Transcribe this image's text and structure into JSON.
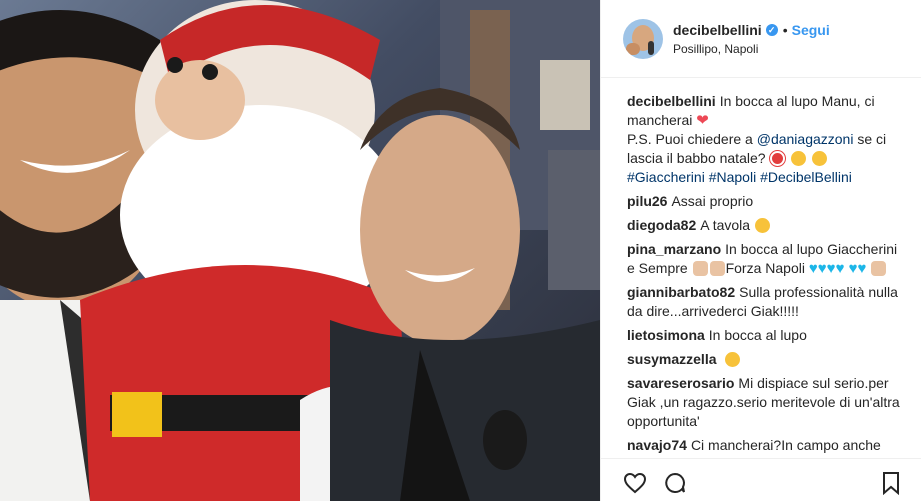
{
  "header": {
    "username": "decibelbellini",
    "verified_icon": "✓",
    "separator": "•",
    "follow_label": "Segui",
    "location": "Posillipo, Napoli"
  },
  "caption": {
    "user": "decibelbellini",
    "line1": "In bocca al lupo Manu, ci mancherai",
    "line2a": "P.S. Puoi chiedere a",
    "mention": "@daniagazzoni",
    "line2b": "se ci lascia il babbo natale?",
    "hashtags": "#Giaccherini #Napoli #DecibelBellini"
  },
  "comments": [
    {
      "user": "pilu26",
      "text": "Assai proprio"
    },
    {
      "user": "diegoda82",
      "text": "A tavola"
    },
    {
      "user": "pina_marzano",
      "text": "In bocca al lupo Giaccherini e Sempre",
      "text2": "Forza Napoli"
    },
    {
      "user": "giannibarbato82",
      "text": "Sulla professionalità nulla da dire...arrivederci Giak!!!!!"
    },
    {
      "user": "lietosimona",
      "text": "In bocca al lupo"
    },
    {
      "user": "susymazzella",
      "text": ""
    },
    {
      "user": "savareserosario",
      "text": "Mi dispiace sul serio.per Giak ,un ragazzo.serio meritevole di un'altra opportunita'"
    },
    {
      "user": "navajo74",
      "text": "Ci mancherai?In campo anche"
    }
  ],
  "icons": {
    "like": "heart-outline-icon",
    "comment": "comment-bubble-icon",
    "save": "bookmark-icon"
  },
  "colors": {
    "link": "#003569",
    "follow": "#3897f0",
    "heart": "#ed4956"
  }
}
